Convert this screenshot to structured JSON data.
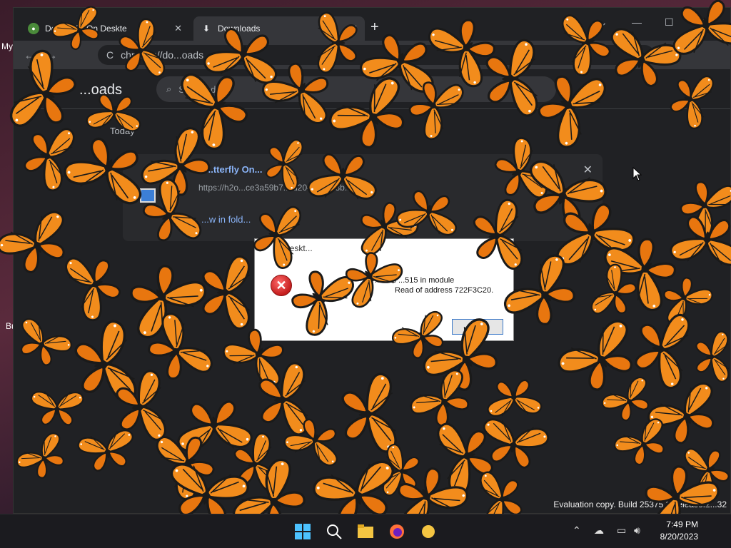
{
  "desktop": {
    "icon_label_1": "My",
    "icon_label_2": "Bu"
  },
  "browser": {
    "tabs": [
      {
        "label": "Do...tterfly On Deskte",
        "active": false
      },
      {
        "label": "Downloads",
        "active": true
      }
    ],
    "omnibox": {
      "prefix": "C",
      "url": "chrome://do...oads"
    },
    "page_title": "...oads",
    "search_placeholder": "Search d...",
    "section_date": "Today",
    "download": {
      "name": "...tterfly On...",
      "url": "https://h2o...ce3a59b7...fd2041ce9e3b...",
      "action": "...w in fold..."
    }
  },
  "dialog": {
    "title": "Deskt...",
    "message_line1": "...ress ...515 in module",
    "message_line2": "Read of address 722F3C20.",
    "ok_label": "OK"
  },
  "watermark": "Evaluation copy. Build 25375.2...elease.2...32",
  "taskbar": {
    "time": "7:49 PM",
    "date": "8/20/2023"
  },
  "colors": {
    "butterfly_orange": "#f28c1c",
    "butterfly_black": "#1a1a1a",
    "dialog_error": "#c41d1d"
  }
}
